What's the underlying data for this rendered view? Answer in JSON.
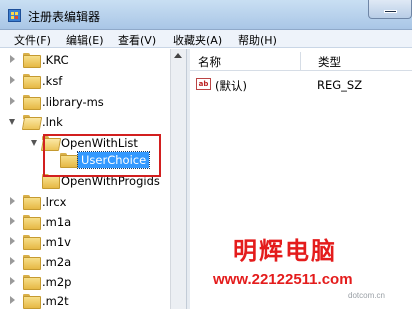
{
  "window": {
    "title": "注册表编辑器"
  },
  "menu": [
    "文件(F)",
    "编辑(E)",
    "查看(V)",
    "收藏夹(A)",
    "帮助(H)"
  ],
  "tree": {
    "items": [
      {
        "label": ".KRC"
      },
      {
        "label": ".ksf"
      },
      {
        "label": ".library-ms"
      },
      {
        "label": ".lnk"
      },
      {
        "label": "OpenWithList"
      },
      {
        "label": "UserChoice"
      },
      {
        "label": "OpenWithProgids"
      },
      {
        "label": ".lrcx"
      },
      {
        "label": ".m1a"
      },
      {
        "label": ".m1v"
      },
      {
        "label": ".m2a"
      },
      {
        "label": ".m2p"
      },
      {
        "label": ".m2t"
      }
    ]
  },
  "values": {
    "col_name": "名称",
    "col_type": "类型",
    "rows": [
      {
        "icon": "ab",
        "name": "(默认)",
        "type": "REG_SZ"
      }
    ]
  },
  "watermark": {
    "brand": "明辉电脑",
    "url": "www.22122511.com",
    "small": "dotcom.cn"
  },
  "colors": {
    "selection": "#3399ff",
    "highlight_box": "#d21f1f",
    "watermark": "#e41c1c"
  }
}
